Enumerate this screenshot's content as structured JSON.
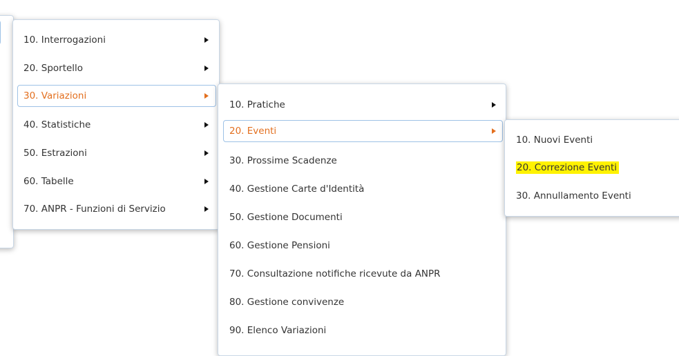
{
  "menu_main": {
    "items": [
      {
        "label": "10. Interrogazioni",
        "has_submenu": true,
        "active": false
      },
      {
        "label": "20. Sportello",
        "has_submenu": true,
        "active": false
      },
      {
        "label": "30. Variazioni",
        "has_submenu": true,
        "active": true
      },
      {
        "label": "40. Statistiche",
        "has_submenu": true,
        "active": false
      },
      {
        "label": "50. Estrazioni",
        "has_submenu": true,
        "active": false
      },
      {
        "label": "60. Tabelle",
        "has_submenu": true,
        "active": false
      },
      {
        "label": "70. ANPR - Funzioni di Servizio",
        "has_submenu": true,
        "active": false
      }
    ]
  },
  "menu_variazioni": {
    "items": [
      {
        "label": "10. Pratiche",
        "has_submenu": true,
        "active": false
      },
      {
        "label": "20. Eventi",
        "has_submenu": true,
        "active": true
      },
      {
        "label": "30. Prossime Scadenze",
        "has_submenu": false,
        "active": false
      },
      {
        "label": "40. Gestione Carte d'Identità",
        "has_submenu": false,
        "active": false
      },
      {
        "label": "50. Gestione Documenti",
        "has_submenu": false,
        "active": false
      },
      {
        "label": "60. Gestione Pensioni",
        "has_submenu": false,
        "active": false
      },
      {
        "label": "70. Consultazione notifiche ricevute da ANPR",
        "has_submenu": false,
        "active": false
      },
      {
        "label": "80. Gestione convivenze",
        "has_submenu": false,
        "active": false
      },
      {
        "label": "90. Elenco Variazioni",
        "has_submenu": false,
        "active": false
      }
    ]
  },
  "menu_eventi": {
    "items": [
      {
        "label": "10. Nuovi Eventi",
        "highlighted": false
      },
      {
        "label": "20. Correzione Eventi",
        "highlighted": true
      },
      {
        "label": "30. Annullamento Eventi",
        "highlighted": false
      }
    ]
  },
  "colors": {
    "active_text": "#e36f1e",
    "active_border": "#9dc1e6",
    "highlight": "#fff200",
    "panel_border": "#c9d7e6"
  }
}
